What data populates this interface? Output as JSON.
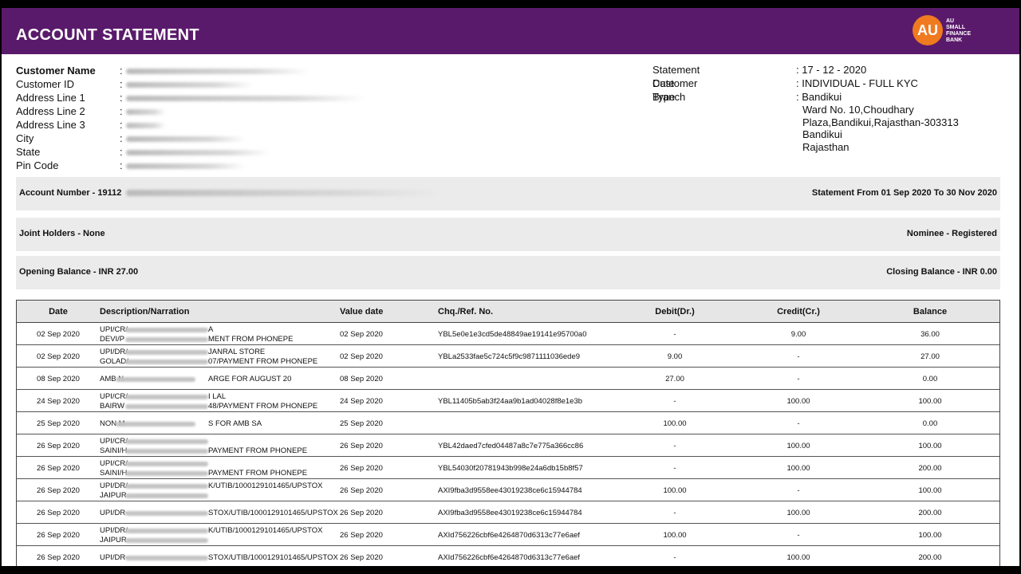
{
  "header": {
    "title": "ACCOUNT STATEMENT",
    "logo_mark": "AU",
    "logo_text": [
      "AU",
      "SMALL",
      "FINANCE",
      "BANK"
    ]
  },
  "customer": [
    {
      "label": "Customer Name"
    },
    {
      "label": "Customer ID"
    },
    {
      "label": "Address Line 1"
    },
    {
      "label": "Address Line 2"
    },
    {
      "label": "Address Line 3"
    },
    {
      "label": "City"
    },
    {
      "label": "State"
    },
    {
      "label": "Pin Code"
    }
  ],
  "statement": {
    "date_label": "Statement Date",
    "date_value": ": 17 - 12 - 2020",
    "type_label": "Customer Type",
    "type_value": ": INDIVIDUAL - FULL KYC",
    "branch_label": "Branch",
    "branch_value": ": Bandikui",
    "branch_lines": [
      "Ward No. 10,Choudhary",
      "Plaza,Bandikui,Rajasthan-303313",
      "Bandikui",
      "Rajasthan"
    ]
  },
  "account": {
    "number": "Account Number  - 19112",
    "period": "Statement From 01 Sep 2020 To 30 Nov 2020",
    "joint": "Joint Holders - None",
    "nominee": "Nominee - Registered",
    "opening": "Opening Balance - INR 27.00",
    "closing": "Closing Balance - INR 0.00"
  },
  "table": {
    "headers": {
      "date": "Date",
      "desc": "Description/Narration",
      "value_date": "Value date",
      "ref": "Chq./Ref. No.",
      "debit": "Debit(Dr.)",
      "credit": "Credit(Cr.)",
      "balance": "Balance"
    },
    "rows": [
      {
        "date": "02 Sep 2020",
        "d1": "UPI/CR/",
        "d1b": "A",
        "d2": "DEVI/P",
        "d2b": "MENT FROM PHONEPE",
        "vdate": "02 Sep 2020",
        "ref": "YBL5e0e1e3cd5de48849ae19141e95700a0",
        "debit": "-",
        "credit": "9.00",
        "balance": "36.00"
      },
      {
        "date": "02 Sep 2020",
        "d1": "UPI/DR/",
        "d1b": "JANRAL STORE",
        "d2": "GOLAD/",
        "d2b": "07/PAYMENT FROM PHONEPE",
        "vdate": "02 Sep 2020",
        "ref": "YBLa2533fae5c724c5f9c9871111036ede9",
        "debit": "9.00",
        "credit": "-",
        "balance": "27.00"
      },
      {
        "date": "08 Sep 2020",
        "d1": "AMB N",
        "d1b": "ARGE FOR AUGUST 20",
        "d2": "",
        "d2b": "",
        "vdate": "08 Sep 2020",
        "ref": "",
        "debit": "27.00",
        "credit": "-",
        "balance": "0.00"
      },
      {
        "date": "24 Sep 2020",
        "d1": "UPI/CR/",
        "d1b": "I LAL",
        "d2": "BAIRW",
        "d2b": "48/PAYMENT FROM PHONEPE",
        "vdate": "24 Sep 2020",
        "ref": "YBL11405b5ab3f24aa9b1ad04028f8e1e3b",
        "debit": "-",
        "credit": "100.00",
        "balance": "100.00"
      },
      {
        "date": "25 Sep 2020",
        "d1": "NON M",
        "d1b": "S FOR AMB SA",
        "d2": "",
        "d2b": "",
        "vdate": "25 Sep 2020",
        "ref": "",
        "debit": "100.00",
        "credit": "-",
        "balance": "0.00"
      },
      {
        "date": "26 Sep 2020",
        "d1": "UPI/CR/",
        "d1b": "",
        "d2": "SAINI/H",
        "d2b": "PAYMENT FROM PHONEPE",
        "vdate": "26 Sep 2020",
        "ref": "YBL42daed7cfed04487a8c7e775a366cc86",
        "debit": "-",
        "credit": "100.00",
        "balance": "100.00"
      },
      {
        "date": "26 Sep 2020",
        "d1": "UPI/CR/",
        "d1b": "",
        "d2": "SAINI/H",
        "d2b": "PAYMENT FROM PHONEPE",
        "vdate": "26 Sep 2020",
        "ref": "YBL54030f20781943b998e24a6db15b8f57",
        "debit": "-",
        "credit": "100.00",
        "balance": "200.00"
      },
      {
        "date": "26 Sep 2020",
        "d1": "UPI/DR/",
        "d1b": "K/UTIB/1000129101465/UPSTOX",
        "d2": "JAIPUR",
        "d2b": "",
        "vdate": "26 Sep 2020",
        "ref": "AXI9fba3d9558ee43019238ce6c15944784",
        "debit": "100.00",
        "credit": "-",
        "balance": "100.00"
      },
      {
        "date": "26 Sep 2020",
        "d1": "UPI/DR-",
        "d1b": "STOX/UTIB/1000129101465/UPSTOX",
        "d2": "",
        "d2b": "",
        "vdate": "26 Sep 2020",
        "ref": "AXI9fba3d9558ee43019238ce6c15944784",
        "debit": "-",
        "credit": "100.00",
        "balance": "200.00"
      },
      {
        "date": "26 Sep 2020",
        "d1": "UPI/DR/",
        "d1b": "K/UTIB/1000129101465/UPSTOX",
        "d2": "JAIPUR",
        "d2b": "",
        "vdate": "26 Sep 2020",
        "ref": "AXId756226cbf6e4264870d6313c77e6aef",
        "debit": "100.00",
        "credit": "-",
        "balance": "100.00"
      },
      {
        "date": "26 Sep 2020",
        "d1": "UPI/DR-",
        "d1b": "STOX/UTIB/1000129101465/UPSTOX",
        "d2": "",
        "d2b": "",
        "vdate": "26 Sep 2020",
        "ref": "AXId756226cbf6e4264870d6313c77e6aef",
        "debit": "-",
        "credit": "100.00",
        "balance": "200.00"
      }
    ]
  }
}
